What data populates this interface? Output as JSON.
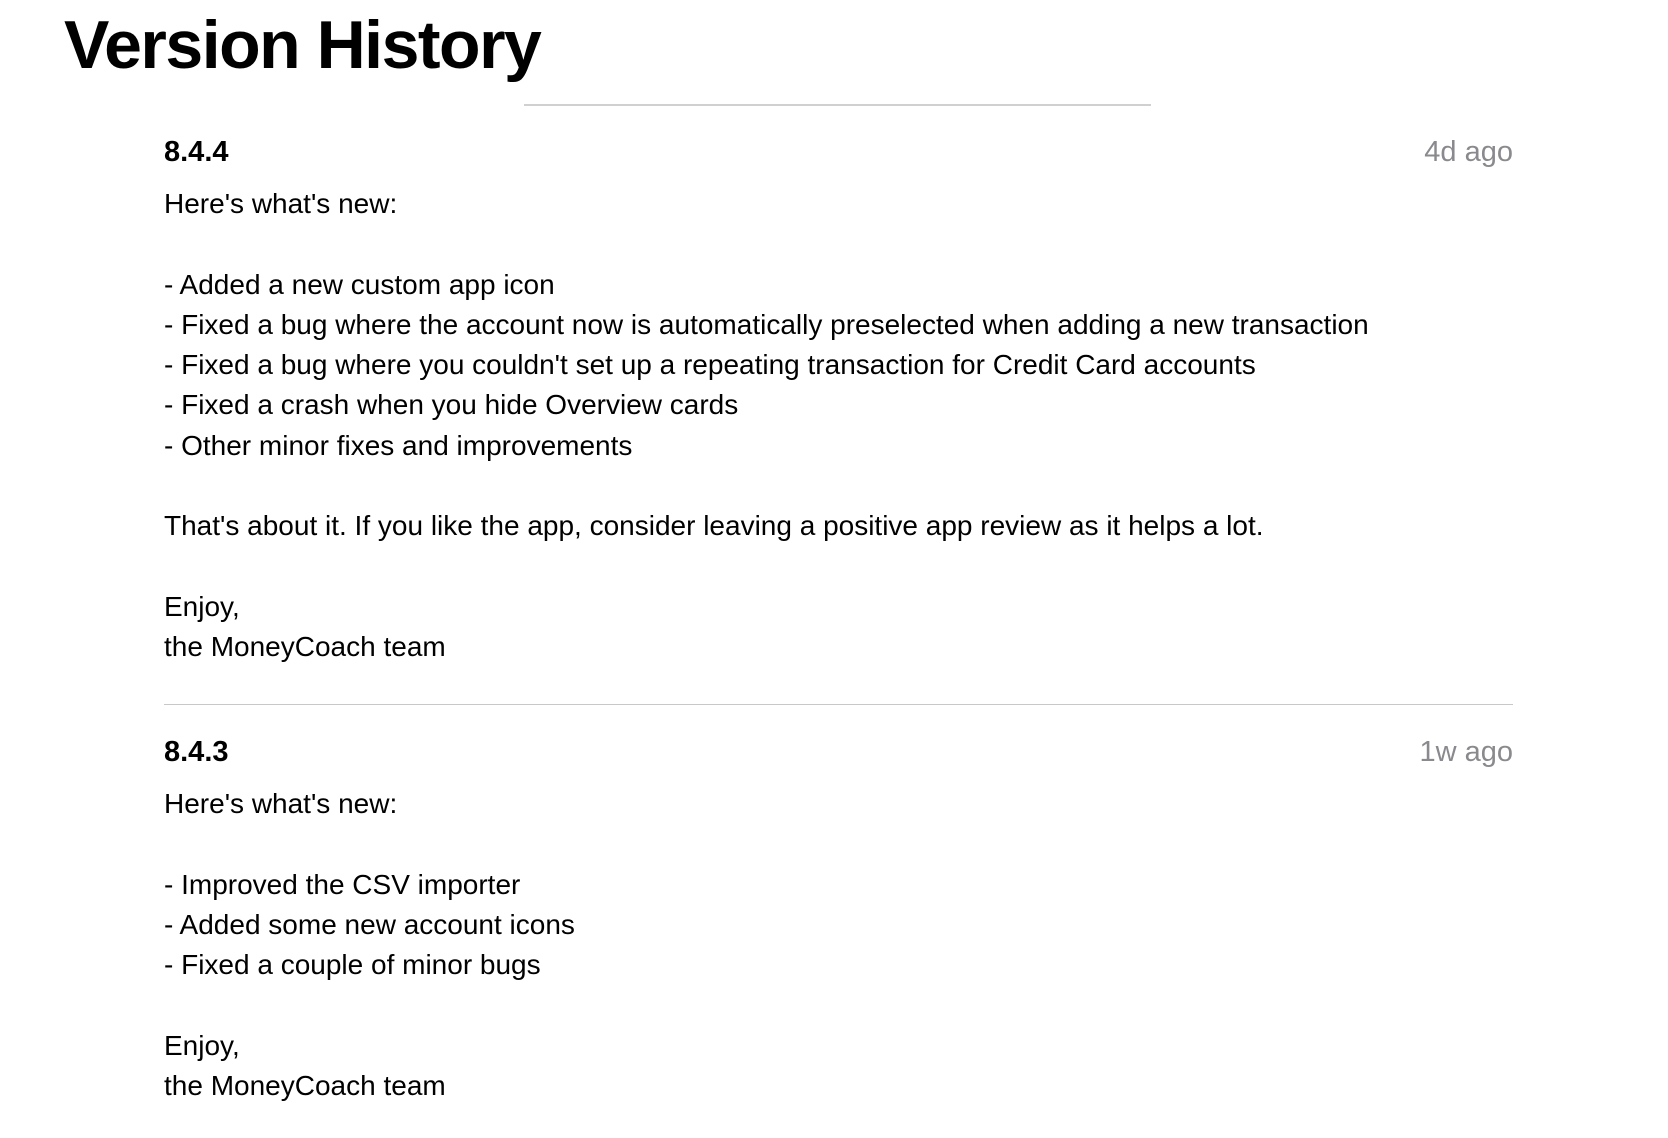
{
  "page": {
    "title": "Version History"
  },
  "versions": [
    {
      "version": "8.4.4",
      "date": "4d ago",
      "lines": [
        "Here's what's new:",
        "",
        "- Added a new custom app icon",
        "- Fixed a bug where the account now is automatically preselected when adding a new transaction",
        "- Fixed a bug where you couldn't set up a repeating transaction for Credit Card accounts",
        "- Fixed a crash when you hide Overview cards",
        "- Other minor fixes and improvements",
        "",
        "That's about it. If you like the app, consider leaving a positive app review as it helps a lot.",
        "",
        "Enjoy,",
        "the MoneyCoach team"
      ]
    },
    {
      "version": "8.4.3",
      "date": "1w ago",
      "lines": [
        "Here's what's new:",
        "",
        "- Improved the CSV importer",
        "- Added some new account icons",
        "- Fixed a couple of minor bugs",
        "",
        "Enjoy,",
        "the MoneyCoach team"
      ]
    }
  ]
}
